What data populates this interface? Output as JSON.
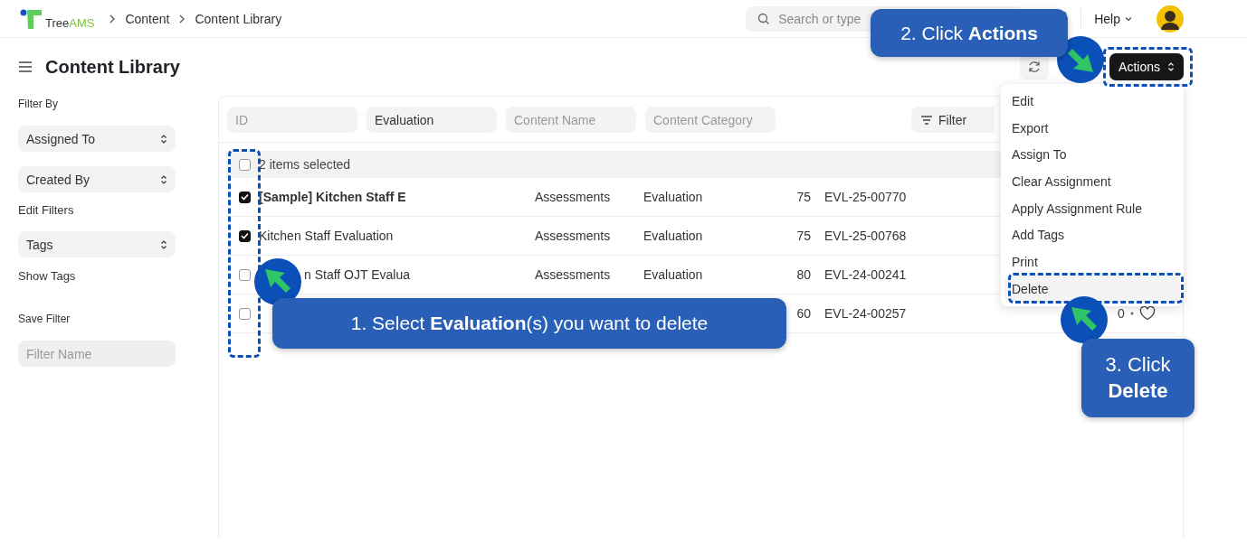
{
  "brand": {
    "part_1": "Tree",
    "part_2": "AMS"
  },
  "breadcrumbs": [
    "Content",
    "Content Library"
  ],
  "search": {
    "placeholder": "Search or type"
  },
  "help": {
    "label": "Help"
  },
  "page": {
    "title": "Content Library"
  },
  "actions_button": {
    "label": "Actions"
  },
  "sidebar": {
    "heading": "Filter By",
    "selects": [
      {
        "label": "Assigned To"
      },
      {
        "label": "Created By"
      }
    ],
    "edit_filters": "Edit Filters",
    "tag_select": {
      "label": "Tags"
    },
    "show_tags": "Show Tags",
    "save_heading": "Save Filter",
    "filter_name": {
      "placeholder": "Filter Name"
    }
  },
  "filters": [
    {
      "placeholder": "ID"
    },
    {
      "value": "Evaluation"
    },
    {
      "placeholder": "Content Name"
    },
    {
      "placeholder": "Content Category"
    }
  ],
  "filter_button": {
    "label": "Filter"
  },
  "table": {
    "header": {
      "checked": false,
      "label": "2 items selected"
    },
    "rows": [
      {
        "checked": true,
        "bold": true,
        "name": "[Sample] Kitchen Staff E",
        "category": "Assessments",
        "type": "Evaluation",
        "score": "75",
        "id": "EVL-25-00770"
      },
      {
        "checked": true,
        "bold": false,
        "name": "Kitchen Staff Evaluation",
        "category": "Assessments",
        "type": "Evaluation",
        "score": "75",
        "id": "EVL-25-00768"
      },
      {
        "checked": false,
        "bold": false,
        "name": "n Staff OJT Evalua",
        "category": "Assessments",
        "type": "Evaluation",
        "score": "80",
        "id": "EVL-24-00241"
      },
      {
        "checked": false,
        "score": "60",
        "id": "EVL-24-00257",
        "comments": "0"
      }
    ]
  },
  "menu": [
    {
      "label": "Edit",
      "selected": false
    },
    {
      "label": "Export",
      "selected": false
    },
    {
      "label": "Assign To",
      "selected": false
    },
    {
      "label": "Clear Assignment",
      "selected": false
    },
    {
      "label": "Apply Assignment Rule",
      "selected": false
    },
    {
      "label": "Add Tags",
      "selected": false
    },
    {
      "label": "Print",
      "selected": false
    },
    {
      "label": "Delete",
      "selected": true
    }
  ],
  "callouts": [
    {
      "kind": "select",
      "text": "1. Select **Evaluation**(s) you want to delete"
    },
    {
      "kind": "actions",
      "text": "2. Click **Actions**"
    },
    {
      "kind": "delete",
      "text": "3. Click **Delete**"
    }
  ]
}
